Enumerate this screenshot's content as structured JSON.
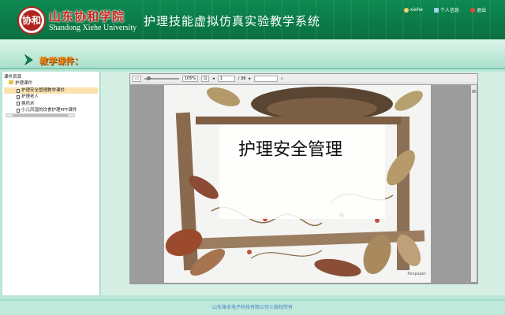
{
  "header": {
    "logo_text": "协和",
    "university_cn": "山东协和学院",
    "university_en": "Shandong Xiehe University",
    "system_title": "护理技能虚拟仿真实验教学系统",
    "user_name": "xiehe",
    "info_link": "个人信息",
    "logout_link": "退出"
  },
  "subnav": {
    "title": "教学课件："
  },
  "sidebar": {
    "root_label": "课件资源",
    "folder_label": "护理课件",
    "items": [
      {
        "label": "护理安全管理教学课件",
        "selected": true
      },
      {
        "label": "护理老人",
        "selected": false
      },
      {
        "label": "换药术",
        "selected": false
      },
      {
        "label": "小儿风湿的饮食护理PPT课件",
        "selected": false
      }
    ]
  },
  "viewer": {
    "zoom": "105%",
    "current_page": "1",
    "total_pages": "/ 36",
    "search_placeholder": "",
    "page_heading": "护理安全管理",
    "watermark": "flexpaper"
  },
  "footer": {
    "copyright": "山东潍业电子科技有限公司©版权所有"
  },
  "colors": {
    "header_green": "#0a7a47",
    "subnav_mint": "#a9e0cb",
    "title_orange": "#f08a1a",
    "footer_link": "#4a7fd1"
  }
}
